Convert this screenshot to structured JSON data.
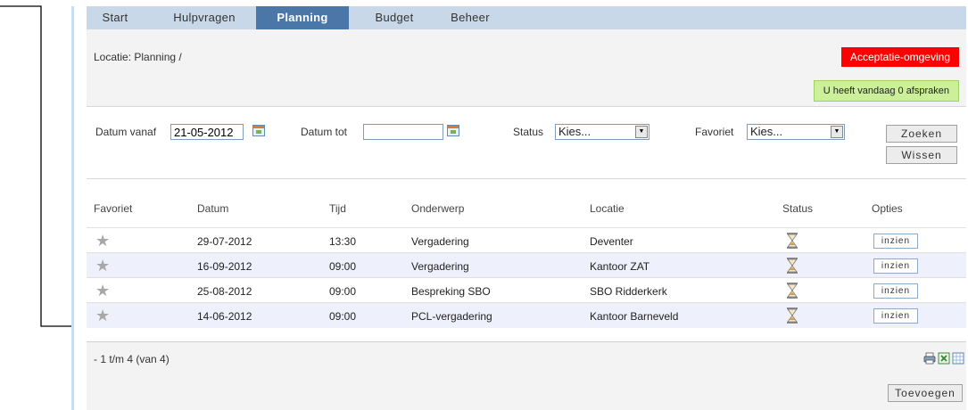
{
  "nav": {
    "tabs": [
      {
        "label": "Start",
        "active": false
      },
      {
        "label": "Hulpvragen",
        "active": false
      },
      {
        "label": "Planning",
        "active": true
      },
      {
        "label": "Budget",
        "active": false
      },
      {
        "label": "Beheer",
        "active": false
      }
    ]
  },
  "header": {
    "location": "Locatie: Planning /",
    "env_badge": "Acceptatie-omgeving",
    "appointments_badge": "U heeft vandaag 0 afspraken"
  },
  "filter": {
    "date_from_label": "Datum vanaf",
    "date_from_value": "21-05-2012",
    "date_to_label": "Datum tot",
    "date_to_value": "",
    "status_label": "Status",
    "status_value": "Kies...",
    "favorite_label": "Favoriet",
    "favorite_value": "Kies...",
    "search_button": "Zoeken",
    "clear_button": "Wissen"
  },
  "table": {
    "columns": [
      "Favoriet",
      "Datum",
      "Tijd",
      "Onderwerp",
      "Locatie",
      "Status",
      "Opties"
    ],
    "rows": [
      {
        "date": "29-07-2012",
        "time": "13:30",
        "subject": "Vergadering",
        "location": "Deventer",
        "action": "inzien"
      },
      {
        "date": "16-09-2012",
        "time": "09:00",
        "subject": "Vergadering",
        "location": "Kantoor ZAT",
        "action": "inzien"
      },
      {
        "date": "25-08-2012",
        "time": "09:00",
        "subject": "Bespreking SBO",
        "location": "SBO Ridderkerk",
        "action": "inzien"
      },
      {
        "date": "14-06-2012",
        "time": "09:00",
        "subject": "PCL-vergadering",
        "location": "Kantoor Barneveld",
        "action": "inzien"
      }
    ]
  },
  "pager": {
    "text": "- 1 t/m 4 (van 4)",
    "icons": [
      "print-icon",
      "excel-icon",
      "calendar-icon"
    ]
  },
  "footer": {
    "add_button": "Toevoegen"
  },
  "colors": {
    "nav_bg": "#c9d8e8",
    "nav_active": "#4a77a8",
    "env_badge": "#ff0000",
    "appointments_badge": "#ccf09a",
    "alt_row": "#eef0fb"
  }
}
